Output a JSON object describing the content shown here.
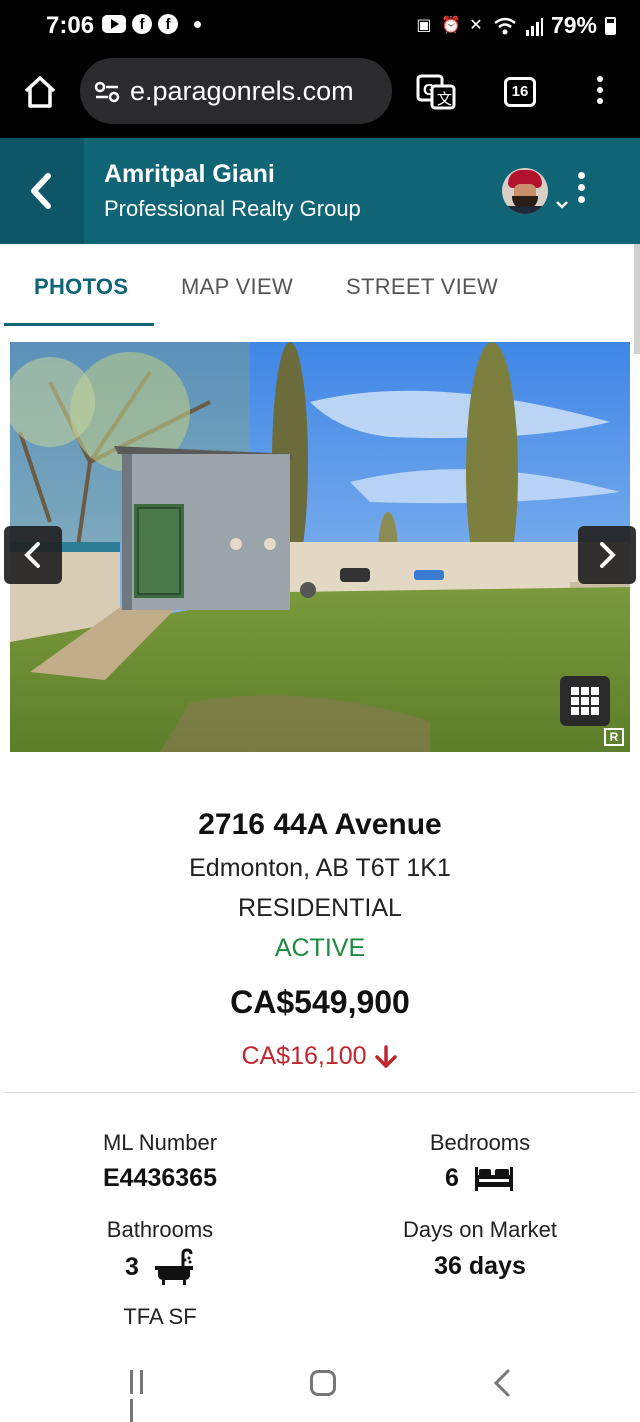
{
  "status_bar": {
    "time": "7:06",
    "battery": "79%",
    "icons": [
      "youtube-icon",
      "facebook-icon",
      "facebook-icon",
      "notification-dot",
      "battery-saver-icon",
      "alarm-icon",
      "mute-icon",
      "wifi-icon",
      "signal-icon",
      "battery-icon"
    ]
  },
  "browser": {
    "url": "e.paragonrels.com",
    "tab_count": "16"
  },
  "header": {
    "agent_name": "Amritpal Giani",
    "company": "Professional Realty Group",
    "accent_color": "#0f6476"
  },
  "tabs": [
    {
      "label": "PHOTOS",
      "active": true
    },
    {
      "label": "MAP VIEW",
      "active": false
    },
    {
      "label": "STREET VIEW",
      "active": false
    }
  ],
  "listing": {
    "address": "2716 44A Avenue",
    "city": "Edmonton, AB T6T 1K1",
    "property_type": "RESIDENTIAL",
    "status": "ACTIVE",
    "price": "CA$549,900",
    "price_drop": "CA$16,100",
    "status_color": "#1e8a3c",
    "drop_color": "#c0262d"
  },
  "facts": {
    "ml_number_label": "ML Number",
    "ml_number": "E4436365",
    "bedrooms_label": "Bedrooms",
    "bedrooms": "6",
    "bathrooms_label": "Bathrooms",
    "bathrooms": "3",
    "days_label": "Days on Market",
    "days": "36 days",
    "tfa_label": "TFA SF"
  }
}
